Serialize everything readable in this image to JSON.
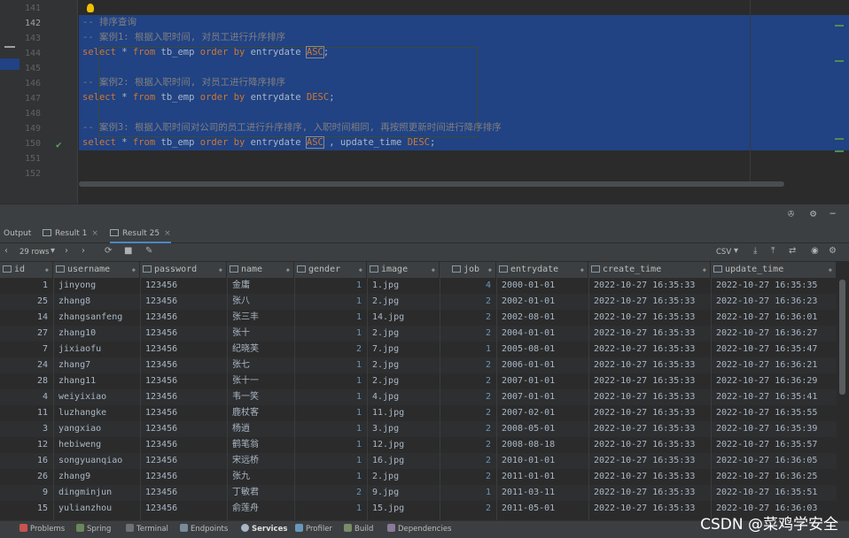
{
  "editor": {
    "lines": [
      {
        "num": "141",
        "text": ""
      },
      {
        "num": "142",
        "text": "-- 排序查询"
      },
      {
        "num": "143",
        "text": "-- 案例1: 根据入职时间, 对员工进行升序排序"
      },
      {
        "num": "144",
        "text": "select * from tb_emp order by entrydate ASC;"
      },
      {
        "num": "145",
        "text": ""
      },
      {
        "num": "146",
        "text": "-- 案例2: 根据入职时间, 对员工进行降序排序"
      },
      {
        "num": "147",
        "text": "select * from tb_emp order by entrydate DESC;"
      },
      {
        "num": "148",
        "text": ""
      },
      {
        "num": "149",
        "text": "-- 案例3: 根据入职时间对公司的员工进行升序排序, 入职时间相同, 再按照更新时间进行降序排序"
      },
      {
        "num": "150",
        "text": "select * from tb_emp order by entrydate ASC , update_time DESC;"
      },
      {
        "num": "151",
        "text": ""
      },
      {
        "num": "152",
        "text": ""
      }
    ],
    "check_icon": "✔"
  },
  "tabs": {
    "output": "Output",
    "result1": "Result 1",
    "result25": "Result 25"
  },
  "toolbar": {
    "rows": "29 rows",
    "csv": "CSV"
  },
  "grid": {
    "columns": [
      "id",
      "username",
      "password",
      "name",
      "gender",
      "image",
      "job",
      "entrydate",
      "create_time",
      "update_time"
    ],
    "rows": [
      [
        "1",
        "jinyong",
        "123456",
        "金庸",
        "1",
        "1.jpg",
        "4",
        "2000-01-01",
        "2022-10-27 16:35:33",
        "2022-10-27 16:35:35"
      ],
      [
        "25",
        "zhang8",
        "123456",
        "张八",
        "1",
        "2.jpg",
        "2",
        "2002-01-01",
        "2022-10-27 16:35:33",
        "2022-10-27 16:36:23"
      ],
      [
        "14",
        "zhangsanfeng",
        "123456",
        "张三丰",
        "1",
        "14.jpg",
        "2",
        "2002-08-01",
        "2022-10-27 16:35:33",
        "2022-10-27 16:36:01"
      ],
      [
        "27",
        "zhang10",
        "123456",
        "张十",
        "1",
        "2.jpg",
        "2",
        "2004-01-01",
        "2022-10-27 16:35:33",
        "2022-10-27 16:36:27"
      ],
      [
        "7",
        "jixiaofu",
        "123456",
        "纪晓芙",
        "2",
        "7.jpg",
        "1",
        "2005-08-01",
        "2022-10-27 16:35:33",
        "2022-10-27 16:35:47"
      ],
      [
        "24",
        "zhang7",
        "123456",
        "张七",
        "1",
        "2.jpg",
        "2",
        "2006-01-01",
        "2022-10-27 16:35:33",
        "2022-10-27 16:36:21"
      ],
      [
        "28",
        "zhang11",
        "123456",
        "张十一",
        "1",
        "2.jpg",
        "2",
        "2007-01-01",
        "2022-10-27 16:35:33",
        "2022-10-27 16:36:29"
      ],
      [
        "4",
        "weiyixiao",
        "123456",
        "韦一笑",
        "1",
        "4.jpg",
        "2",
        "2007-01-01",
        "2022-10-27 16:35:33",
        "2022-10-27 16:35:41"
      ],
      [
        "11",
        "luzhangke",
        "123456",
        "鹿杖客",
        "1",
        "11.jpg",
        "2",
        "2007-02-01",
        "2022-10-27 16:35:33",
        "2022-10-27 16:35:55"
      ],
      [
        "3",
        "yangxiao",
        "123456",
        "杨逍",
        "1",
        "3.jpg",
        "2",
        "2008-05-01",
        "2022-10-27 16:35:33",
        "2022-10-27 16:35:39"
      ],
      [
        "12",
        "hebiweng",
        "123456",
        "鹤笔翁",
        "1",
        "12.jpg",
        "2",
        "2008-08-18",
        "2022-10-27 16:35:33",
        "2022-10-27 16:35:57"
      ],
      [
        "16",
        "songyuanqiao",
        "123456",
        "宋远桥",
        "1",
        "16.jpg",
        "2",
        "2010-01-01",
        "2022-10-27 16:35:33",
        "2022-10-27 16:36:05"
      ],
      [
        "26",
        "zhang9",
        "123456",
        "张九",
        "1",
        "2.jpg",
        "2",
        "2011-01-01",
        "2022-10-27 16:35:33",
        "2022-10-27 16:36:25"
      ],
      [
        "9",
        "dingminjun",
        "123456",
        "丁敏君",
        "2",
        "9.jpg",
        "1",
        "2011-03-11",
        "2022-10-27 16:35:33",
        "2022-10-27 16:35:51"
      ],
      [
        "15",
        "yulianzhou",
        "123456",
        "俞莲舟",
        "1",
        "15.jpg",
        "2",
        "2011-05-01",
        "2022-10-27 16:35:33",
        "2022-10-27 16:36:03"
      ]
    ]
  },
  "bottombar": {
    "problems": "Problems",
    "spring": "Spring",
    "terminal": "Terminal",
    "endpoints": "Endpoints",
    "services": "Services",
    "profiler": "Profiler",
    "build": "Build",
    "dependencies": "Dependencies"
  },
  "watermark": "CSDN @菜鸡学安全"
}
